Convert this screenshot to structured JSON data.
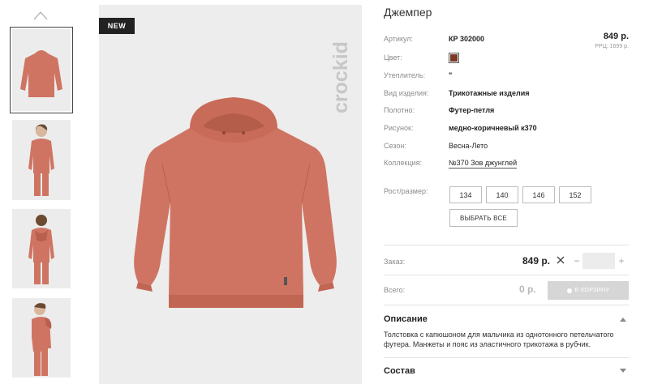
{
  "gallery": {
    "thumbnails": [
      {
        "name": "thumb-hoodie-flat"
      },
      {
        "name": "thumb-model-front"
      },
      {
        "name": "thumb-model-back"
      },
      {
        "name": "thumb-model-side"
      }
    ],
    "badge": "NEW",
    "brand_logo_text": "crockid",
    "garment_color": "#cf7462"
  },
  "product": {
    "title": "Джемпер",
    "price": "849 р.",
    "rrp": "РРЦ: 1699 р.",
    "color_swatch": "#7a3a26",
    "attributes": [
      {
        "label": "Артикул:",
        "value": "КР 302000"
      },
      {
        "label": "Цвет:",
        "value": ""
      },
      {
        "label": "Утеплитель:",
        "value": "\""
      },
      {
        "label": "Вид изделия:",
        "value": "Трикотажные изделия"
      },
      {
        "label": "Полотно:",
        "value": "Футер-петля"
      },
      {
        "label": "Рисунок:",
        "value": "медно-коричневый к370"
      },
      {
        "label": "Сезон:",
        "value": "Весна-Лето"
      },
      {
        "label": "Коллекция:",
        "value": "№370 Зов джунглей"
      }
    ]
  },
  "sizes": {
    "label": "Рост/размер:",
    "options": [
      "134",
      "140",
      "146",
      "152"
    ],
    "select_all": "ВЫБРАТЬ ВСЕ"
  },
  "order": {
    "label": "Заказ:",
    "price": "849 р.",
    "minus": "−",
    "plus": "+",
    "quantity": ""
  },
  "total": {
    "label": "Всего:",
    "value": "0 р.",
    "cart_button": "В КОРЗИНУ"
  },
  "sections": {
    "description_title": "Описание",
    "description_text": "Толстовка с капюшоном для мальчика из однотонного петельчатого футера. Манжеты и пояс из эластичного трикотажа в рубчик.",
    "composition_title": "Состав"
  }
}
